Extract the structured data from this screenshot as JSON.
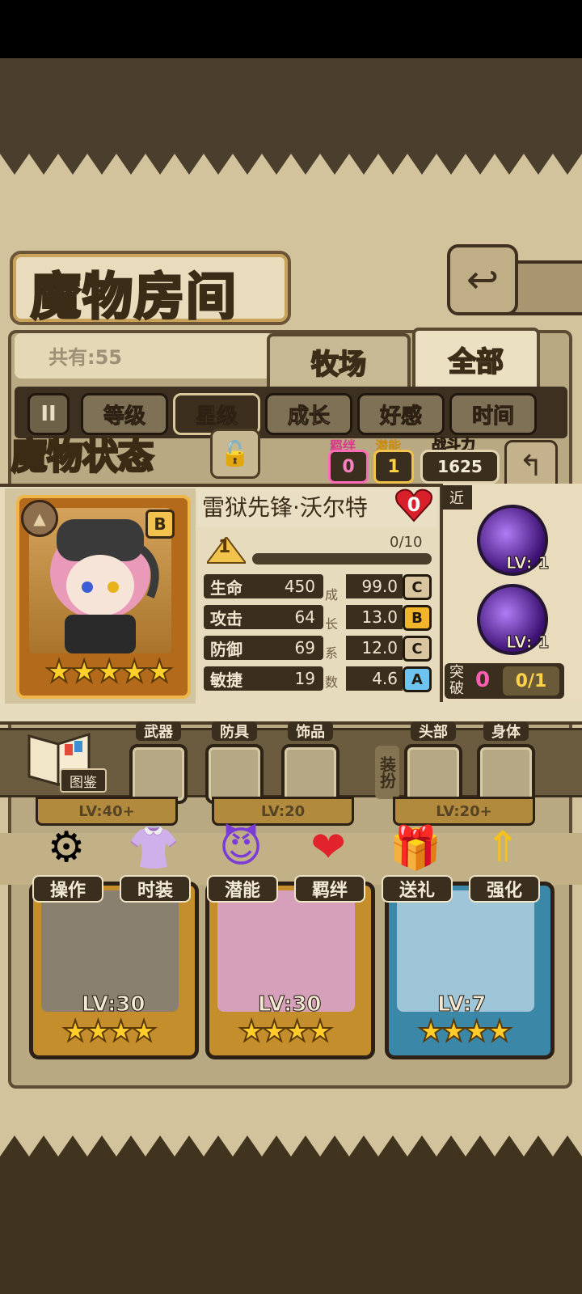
{
  "room": {
    "title": "魔物房间",
    "count_text": "共有:55",
    "tabs": [
      "牧场",
      "全部"
    ],
    "sort": {
      "icon": "II",
      "buttons": [
        "等级",
        "星级",
        "成长",
        "好感",
        "时间"
      ],
      "active": "星级"
    }
  },
  "status": {
    "title": "魔物状态",
    "bond_label": "羁绊",
    "bond_value": "0",
    "potential_label": "潜能",
    "potential_value": "1",
    "power_label": "战斗力",
    "power_value": "1625"
  },
  "monster": {
    "name": "雷狱先锋·沃尔特",
    "affection": "0",
    "rank": "B",
    "stars": "★★★★★",
    "level": "1",
    "exp_text": "0/10",
    "exp_fraction": 0,
    "growth_label": [
      "成",
      "长",
      "系",
      "数"
    ],
    "stats": [
      {
        "name": "生命",
        "value": "450",
        "growth": "99.0",
        "grade": "C"
      },
      {
        "name": "攻击",
        "value": "64",
        "growth": "13.0",
        "grade": "B"
      },
      {
        "name": "防御",
        "value": "69",
        "growth": "12.0",
        "grade": "C"
      },
      {
        "name": "敏捷",
        "value": "19",
        "growth": "4.6",
        "grade": "A"
      }
    ]
  },
  "skills": {
    "range_tag": "近",
    "items": [
      {
        "lv": "LV: 1"
      },
      {
        "lv": "LV: 1"
      }
    ],
    "breach_label": "突破",
    "breach_value": "0",
    "breach_count": "0/1"
  },
  "equipment": {
    "book_label": "图鉴",
    "slots": [
      "武器",
      "防具",
      "饰品",
      "头部",
      "身体"
    ],
    "dress_label": "装扮"
  },
  "actions": [
    "操作",
    "时装",
    "潜能",
    "羁绊",
    "送礼",
    "强化"
  ],
  "cards": [
    {
      "lv": "LV:30",
      "stars": "★★★★",
      "top": "LV:40+"
    },
    {
      "lv": "LV:30",
      "stars": "★★★★",
      "top": "LV:20"
    },
    {
      "lv": "LV:7",
      "stars": "★★★★",
      "top": "LV:20+"
    }
  ],
  "colors": {
    "bond": "#ff6bb5",
    "potential": "#f2c34c",
    "grade_C": "#d9c6a0",
    "grade_B": "#f2b52a",
    "grade_A": "#6ec4f0"
  }
}
